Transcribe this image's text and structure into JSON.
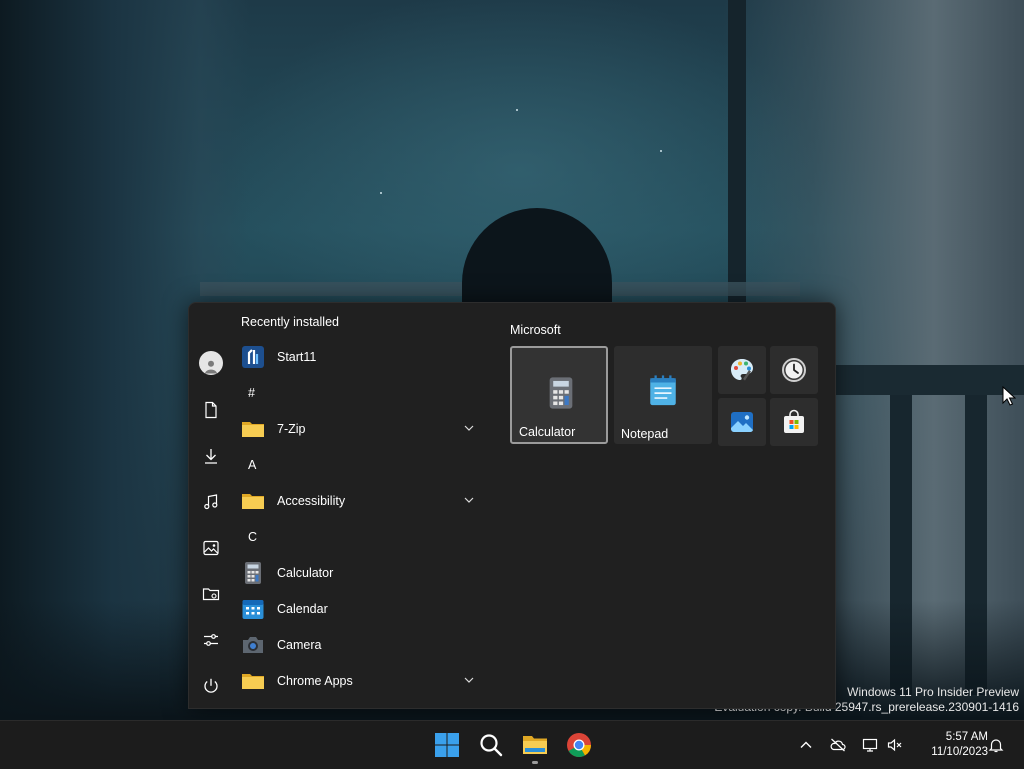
{
  "watermark": {
    "line1": "Windows 11 Pro Insider Preview",
    "line2": "Evaluation copy. Build 25947.rs_prerelease.230901-1416"
  },
  "start_menu": {
    "recent_heading": "Recently installed",
    "apps": [
      {
        "type": "app",
        "label": "Start11",
        "icon": "start11-icon"
      },
      {
        "type": "letter",
        "label": "#"
      },
      {
        "type": "folder",
        "label": "7-Zip",
        "icon": "folder-icon",
        "expandable": true
      },
      {
        "type": "letter",
        "label": "A"
      },
      {
        "type": "folder",
        "label": "Accessibility",
        "icon": "folder-icon",
        "expandable": true
      },
      {
        "type": "letter",
        "label": "C"
      },
      {
        "type": "app",
        "label": "Calculator",
        "icon": "calculator-icon"
      },
      {
        "type": "app",
        "label": "Calendar",
        "icon": "calendar-icon"
      },
      {
        "type": "app",
        "label": "Camera",
        "icon": "camera-icon"
      },
      {
        "type": "folder",
        "label": "Chrome Apps",
        "icon": "folder-icon",
        "expandable": true
      }
    ],
    "pinned_heading": "Microsoft",
    "pinned_large": [
      {
        "label": "Calculator",
        "icon": "calculator-icon",
        "selected": true
      },
      {
        "label": "Notepad",
        "icon": "notepad-icon",
        "selected": false
      }
    ],
    "pinned_small": [
      "paint-icon",
      "clock-icon",
      "photos-icon",
      "store-icon"
    ],
    "rail_icons": [
      "user-avatar",
      "documents-icon",
      "downloads-icon",
      "music-icon",
      "pictures-icon",
      "network-folder-icon",
      "settings-icon",
      "power-icon"
    ]
  },
  "taskbar": {
    "icons": [
      "windows-start-icon",
      "search-icon",
      "file-explorer-icon",
      "chrome-icon"
    ],
    "tray_icons": [
      "chevron-up-icon",
      "onedrive-offline-icon",
      "network-icon",
      "volume-muted-icon",
      "notification-bell-icon"
    ],
    "time": "5:57 AM",
    "date": "11/10/2023"
  },
  "colors": {
    "start_bg": "#202020",
    "tile_bg": "#2d2d2d",
    "taskbar_bg": "#1c1c1c",
    "folder_yellow": "#f2c44a",
    "accent_blue": "#2a8fd8"
  }
}
